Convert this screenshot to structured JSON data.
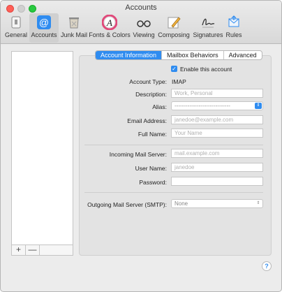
{
  "window": {
    "title": "Accounts"
  },
  "toolbar": {
    "items": [
      {
        "label": "General",
        "icon": "general-icon"
      },
      {
        "label": "Accounts",
        "icon": "at-sign-icon",
        "active": true
      },
      {
        "label": "Junk Mail",
        "icon": "junk-mail-icon"
      },
      {
        "label": "Fonts & Colors",
        "icon": "fonts-colors-icon"
      },
      {
        "label": "Viewing",
        "icon": "glasses-icon"
      },
      {
        "label": "Composing",
        "icon": "pencil-icon"
      },
      {
        "label": "Signatures",
        "icon": "signature-icon"
      },
      {
        "label": "Rules",
        "icon": "rules-icon"
      }
    ]
  },
  "account_list": {
    "add_label": "+",
    "remove_label": "—"
  },
  "tabs": [
    {
      "label": "Account Information",
      "active": true
    },
    {
      "label": "Mailbox Behaviors",
      "active": false
    },
    {
      "label": "Advanced",
      "active": false
    }
  ],
  "form": {
    "enable_label": "Enable this account",
    "enable_checked": true,
    "account_type_label": "Account Type:",
    "account_type_value": "IMAP",
    "description_label": "Description:",
    "description_placeholder": "Work, Personal",
    "alias_label": "Alias:",
    "alias_value": "------------------------------",
    "email_label": "Email Address:",
    "email_placeholder": "janedoe@example.com",
    "fullname_label": "Full Name:",
    "fullname_placeholder": "Your Name",
    "incoming_label": "Incoming Mail Server:",
    "incoming_placeholder": "mail.example.com",
    "username_label": "User Name:",
    "username_placeholder": "janedoe",
    "password_label": "Password:",
    "password_placeholder": "",
    "smtp_label": "Outgoing Mail Server (SMTP):",
    "smtp_value": "None"
  },
  "help": {
    "label": "?"
  },
  "colors": {
    "accent": "#2f8cf0",
    "close": "#ff5f57",
    "zoom": "#28c940"
  }
}
